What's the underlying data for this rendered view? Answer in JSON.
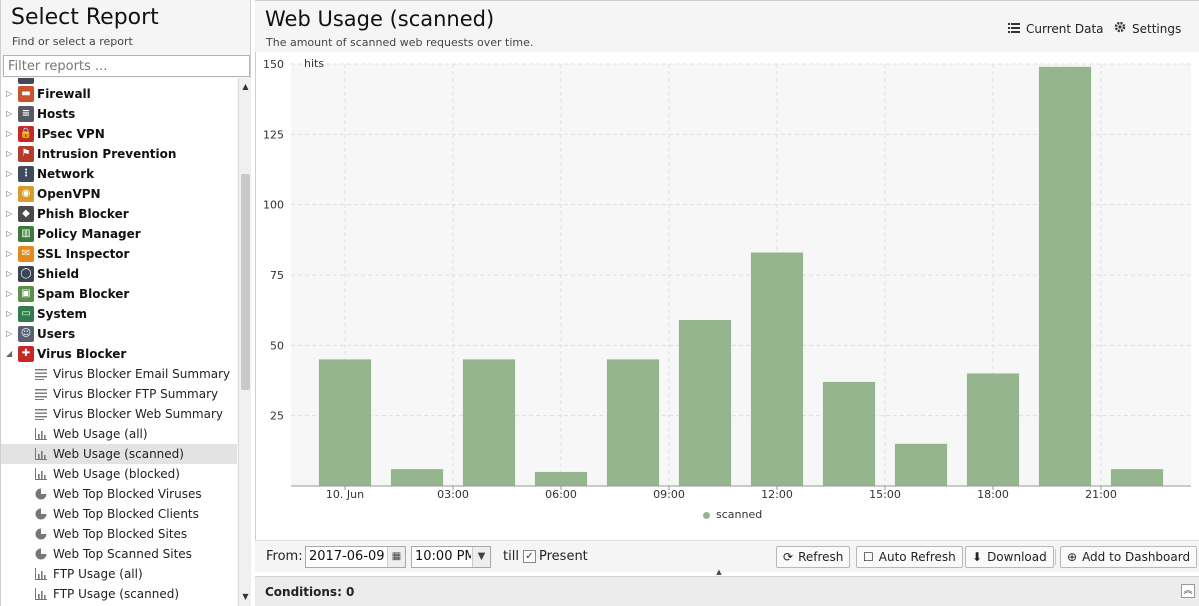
{
  "left": {
    "title": "Select Report",
    "subtitle": "Find or select a report",
    "filter_placeholder": "Filter reports ..."
  },
  "tree": [
    {
      "type": "category",
      "label": "Firewall",
      "icon": "firewall-icon",
      "color": "#c8532e",
      "expanded": false
    },
    {
      "type": "category",
      "label": "Hosts",
      "icon": "hosts-icon",
      "color": "#555a66",
      "expanded": false
    },
    {
      "type": "category",
      "label": "IPsec VPN",
      "icon": "lock-icon",
      "color": "#c62727",
      "expanded": false
    },
    {
      "type": "category",
      "label": "Intrusion Prevention",
      "icon": "intrusion-prevention-icon",
      "color": "#b33c2b",
      "expanded": false
    },
    {
      "type": "category",
      "label": "Network",
      "icon": "network-icon",
      "color": "#3f4a5c",
      "expanded": false
    },
    {
      "type": "category",
      "label": "OpenVPN",
      "icon": "openvpn-icon",
      "color": "#d99c2b",
      "expanded": false
    },
    {
      "type": "category",
      "label": "Phish Blocker",
      "icon": "phish-blocker-icon",
      "color": "#4a4a4a",
      "expanded": false
    },
    {
      "type": "category",
      "label": "Policy Manager",
      "icon": "policy-manager-icon",
      "color": "#3a7a3a",
      "expanded": false
    },
    {
      "type": "category",
      "label": "SSL Inspector",
      "icon": "ssl-inspector-icon",
      "color": "#e48a1c",
      "expanded": false
    },
    {
      "type": "category",
      "label": "Shield",
      "icon": "shield-icon",
      "color": "#3b4454",
      "expanded": false
    },
    {
      "type": "category",
      "label": "Spam Blocker",
      "icon": "spam-blocker-icon",
      "color": "#5c8f4a",
      "expanded": false
    },
    {
      "type": "category",
      "label": "System",
      "icon": "system-icon",
      "color": "#2e7d4a",
      "expanded": false
    },
    {
      "type": "category",
      "label": "Users",
      "icon": "users-icon",
      "color": "#596170",
      "expanded": false
    },
    {
      "type": "category",
      "label": "Virus Blocker",
      "icon": "virus-blocker-icon",
      "color": "#c62828",
      "expanded": true
    },
    {
      "type": "report",
      "label": "Virus Blocker Email Summary",
      "icon": "text-report-icon"
    },
    {
      "type": "report",
      "label": "Virus Blocker FTP Summary",
      "icon": "text-report-icon"
    },
    {
      "type": "report",
      "label": "Virus Blocker Web Summary",
      "icon": "text-report-icon"
    },
    {
      "type": "report",
      "label": "Web Usage (all)",
      "icon": "bar-chart-icon"
    },
    {
      "type": "report",
      "label": "Web Usage (scanned)",
      "icon": "bar-chart-icon",
      "selected": true
    },
    {
      "type": "report",
      "label": "Web Usage (blocked)",
      "icon": "bar-chart-icon"
    },
    {
      "type": "report",
      "label": "Web Top Blocked Viruses",
      "icon": "pie-chart-icon"
    },
    {
      "type": "report",
      "label": "Web Top Blocked Clients",
      "icon": "pie-chart-icon"
    },
    {
      "type": "report",
      "label": "Web Top Blocked Sites",
      "icon": "pie-chart-icon"
    },
    {
      "type": "report",
      "label": "Web Top Scanned Sites",
      "icon": "pie-chart-icon"
    },
    {
      "type": "report",
      "label": "FTP Usage (all)",
      "icon": "bar-chart-icon"
    },
    {
      "type": "report",
      "label": "FTP Usage (scanned)",
      "icon": "bar-chart-icon"
    }
  ],
  "report": {
    "title": "Web Usage (scanned)",
    "subtitle": "The amount of scanned web requests over time.",
    "current_data_label": "Current Data",
    "settings_label": "Settings"
  },
  "chart_data": {
    "type": "bar",
    "ylabel": "hits",
    "ylim": [
      0,
      150
    ],
    "yticks": [
      0,
      25,
      50,
      75,
      100,
      125,
      150
    ],
    "x_axis_labels": [
      "10. Jun",
      "03:00",
      "06:00",
      "09:00",
      "12:00",
      "15:00",
      "18:00",
      "21:00"
    ],
    "x_axis_hours": [
      0,
      3,
      6,
      9,
      12,
      15,
      18,
      21
    ],
    "xlim_hours": [
      -1.5,
      23.5
    ],
    "x_hours": [
      0,
      2,
      4,
      6,
      8,
      10,
      12,
      14,
      16,
      18,
      20,
      22
    ],
    "series": [
      {
        "name": "scanned",
        "color": "#95b58f",
        "values": [
          45,
          6,
          45,
          5,
          45,
          59,
          83,
          37,
          15,
          40,
          149,
          6
        ]
      }
    ],
    "grid": true,
    "legend_position": "bottom"
  },
  "toolbar": {
    "from_label": "From:",
    "from_date": "2017-06-09",
    "from_time": "10:00 PM",
    "till_label": "till",
    "present_label": "Present",
    "present_checked": true,
    "refresh_label": "Refresh",
    "auto_refresh_label": "Auto Refresh",
    "download_label": "Download",
    "add_dashboard_label": "Add to Dashboard"
  },
  "conditions": {
    "label": "Conditions: 0"
  }
}
